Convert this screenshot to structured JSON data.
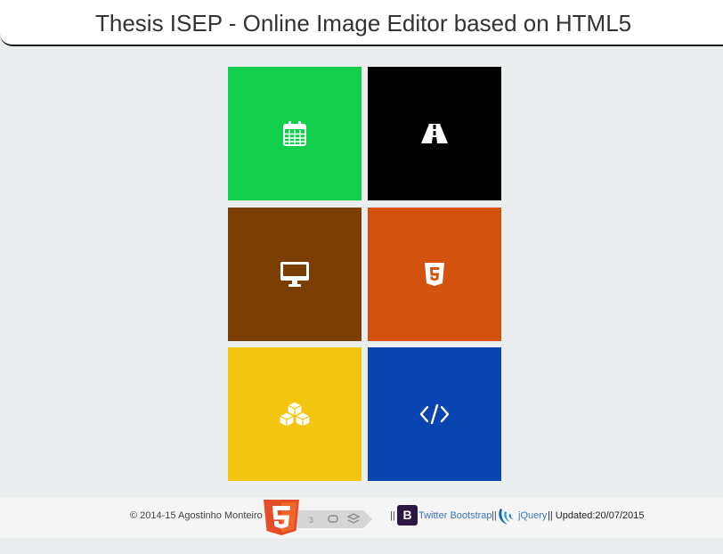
{
  "header": {
    "title": "Thesis ISEP - Online Image Editor based on HTML5"
  },
  "tiles": [
    {
      "icon": "calendar-icon",
      "color": "#11cf4a"
    },
    {
      "icon": "road-icon",
      "color": "#000000"
    },
    {
      "icon": "monitor-icon",
      "color": "#7a3e02"
    },
    {
      "icon": "html5-icon",
      "color": "#d35210"
    },
    {
      "icon": "cubes-icon",
      "color": "#f2c511"
    },
    {
      "icon": "code-icon",
      "color": "#0a44b0"
    }
  ],
  "footer": {
    "copyright": "© 2014-15 Agostinho Monteiro",
    "separator": "||",
    "bootstrap_logo": "B",
    "bootstrap_link": "Twitter Bootstrap",
    "jquery_link": "jQuery",
    "updated": "|| Updated:20/07/2015"
  }
}
